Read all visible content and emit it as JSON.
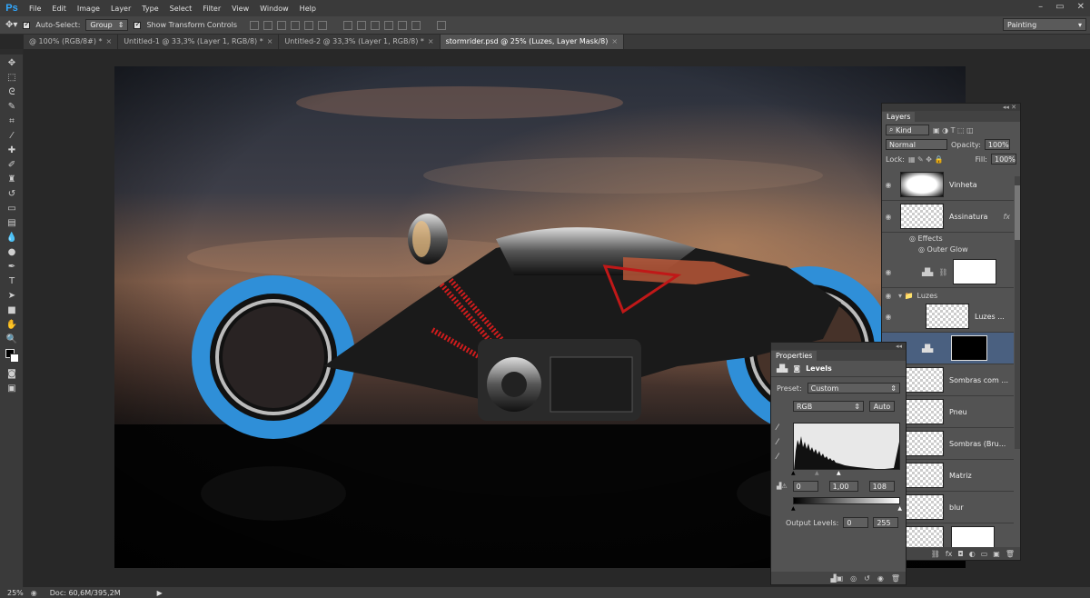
{
  "app": {
    "logo": "Ps"
  },
  "menu": [
    "File",
    "Edit",
    "Image",
    "Layer",
    "Type",
    "Select",
    "Filter",
    "View",
    "Window",
    "Help"
  ],
  "options": {
    "auto_select": "Auto-Select:",
    "group_value": "Group",
    "show_transform": "Show Transform Controls",
    "workspace": "Painting"
  },
  "tabs": [
    {
      "label": "@ 100% (RGB/8#) *"
    },
    {
      "label": "Untitled-1 @ 33,3% (Layer 1, RGB/8) *"
    },
    {
      "label": "Untitled-2 @ 33,3% (Layer 1, RGB/8) *"
    },
    {
      "label": "stormrider.psd @ 25% (Luzes, Layer Mask/8)"
    }
  ],
  "status": {
    "zoom": "25%",
    "doc": "Doc: 60,6M/395,2M"
  },
  "layers_panel": {
    "title": "Layers",
    "kind": "Kind",
    "blend": "Normal",
    "opacity_label": "Opacity:",
    "opacity": "100%",
    "lock_label": "Lock:",
    "fill_label": "Fill:",
    "fill": "100%",
    "effects_label": "Effects",
    "outer_glow": "Outer Glow",
    "group_name": "Luzes",
    "layers": [
      "Vinheta",
      "Assinatura",
      "Luzes ...",
      "Sombras com ...",
      "Pneu",
      "Sombras (Bru...",
      "Matriz",
      "blur"
    ]
  },
  "properties_panel": {
    "title": "Properties",
    "adjustment": "Levels",
    "preset_label": "Preset:",
    "preset_value": "Custom",
    "channel": "RGB",
    "auto": "Auto",
    "input_black": "0",
    "input_gamma": "1,00",
    "input_white": "108",
    "output_label": "Output Levels:",
    "output_black": "0",
    "output_white": "255"
  },
  "colors": {
    "bg": "#282828",
    "panel": "#535353",
    "accent": "#31a8ff"
  }
}
